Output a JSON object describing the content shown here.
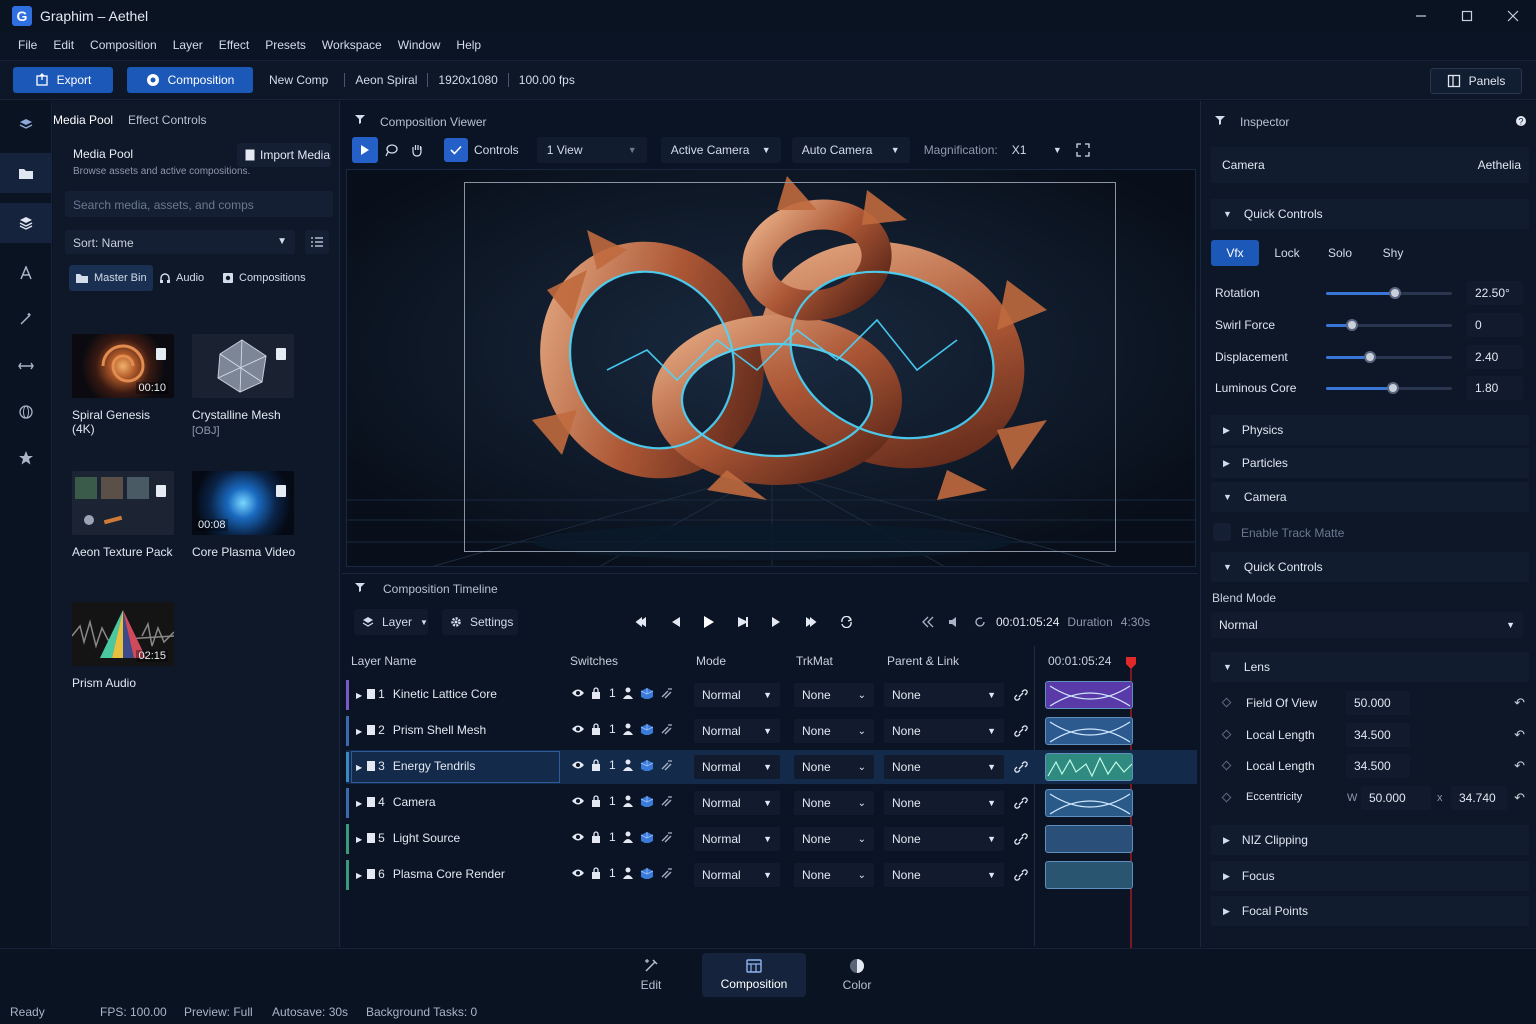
{
  "app": {
    "title": "Graphim – Aethel",
    "logo_letter": "G"
  },
  "menu": [
    "File",
    "Edit",
    "Composition",
    "Layer",
    "Effect",
    "Presets",
    "Workspace",
    "Window",
    "Help"
  ],
  "toolbar": {
    "export": "Export",
    "composition": "Composition",
    "new_comp": "New Comp",
    "comp_name": "Aeon Spiral",
    "resolution": "1920x1080",
    "fps": "100.00 fps",
    "panels": "Panels"
  },
  "left_panel": {
    "tabs": [
      "Media Pool",
      "Effect Controls"
    ],
    "title": "Media Pool",
    "subtitle": "Browse assets and active compositions.",
    "import_button": "Import Media",
    "search_placeholder": "Search media, assets, and comps",
    "sort": "Sort: Name",
    "filters": [
      "Master Bin",
      "Audio",
      "Compositions"
    ],
    "assets": [
      {
        "name": "Spiral Genesis (4K)",
        "sub": "",
        "duration": "00:10"
      },
      {
        "name": "Crystalline Mesh",
        "sub": "[OBJ]",
        "duration": ""
      },
      {
        "name": "Aeon Texture Pack",
        "sub": "",
        "duration": ""
      },
      {
        "name": "Core Plasma Video",
        "sub": "",
        "duration": "00:08"
      },
      {
        "name": "Prism Audio",
        "sub": "",
        "duration": "02:15"
      }
    ]
  },
  "viewer": {
    "title": "Composition Viewer",
    "controls": "Controls",
    "view": "1 View",
    "camera": "Active Camera",
    "auto_camera": "Auto Camera",
    "magnification_label": "Magnification:",
    "magnification": "X1"
  },
  "timeline": {
    "title": "Composition Timeline",
    "layer_btn": "Layer",
    "settings_btn": "Settings",
    "timecode": "00:01:05:24",
    "duration_label": "Duration",
    "duration": "4:30s",
    "columns": {
      "name": "Layer Name",
      "switches": "Switches",
      "mode": "Mode",
      "trkmat": "TrkMat",
      "parent": "Parent & Link",
      "time": "00:01:05:24"
    },
    "layers": [
      {
        "num": "1",
        "name": "Kinetic Lattice Core",
        "mode": "Normal",
        "trkmat": "None",
        "parent": "None",
        "accent": "#7a5ac8",
        "clip": "#5a3aa8"
      },
      {
        "num": "2",
        "name": "Prism Shell Mesh",
        "mode": "Normal",
        "trkmat": "None",
        "parent": "None",
        "accent": "#3a6ab0",
        "clip": "#2c5a8e"
      },
      {
        "num": "3",
        "name": "Energy Tendrils",
        "mode": "Normal",
        "trkmat": "None",
        "parent": "None",
        "accent": "#3a8ac0",
        "clip": "#2f8a80"
      },
      {
        "num": "4",
        "name": "Camera",
        "mode": "Normal",
        "trkmat": "None",
        "parent": "None",
        "accent": "#3a6ab0",
        "clip": "#2a5a88"
      },
      {
        "num": "5",
        "name": "Light Source",
        "mode": "Normal",
        "trkmat": "None",
        "parent": "None",
        "accent": "#3a9a7a",
        "clip": "#2a4f78"
      },
      {
        "num": "6",
        "name": "Plasma Core Render",
        "mode": "Normal",
        "trkmat": "None",
        "parent": "None",
        "accent": "#3a9a7a",
        "clip": "#2a5570"
      }
    ],
    "switch_num": "1"
  },
  "inspector": {
    "title": "Inspector",
    "object_label": "Camera",
    "object_value": "Aethelia",
    "quick_controls": "Quick Controls",
    "qc_buttons": [
      "Vfx",
      "Lock",
      "Solo",
      "Shy"
    ],
    "sliders": [
      {
        "label": "Rotation",
        "value": "22.50°",
        "level": 0.55
      },
      {
        "label": "Swirl Force",
        "value": "0",
        "level": 0.21
      },
      {
        "label": "Displacement",
        "value": "2.40",
        "level": 0.35
      },
      {
        "label": "Luminous Core",
        "value": "1.80",
        "level": 0.53
      }
    ],
    "sections": {
      "physics": "Physics",
      "particles": "Particles",
      "camera": "Camera",
      "track_matte": "Enable Track Matte",
      "quick_controls_2": "Quick Controls",
      "blend_mode_label": "Blend Mode",
      "blend_mode": "Normal",
      "lens": "Lens",
      "niz": "NIZ Clipping",
      "focus": "Focus",
      "focal_points": "Focal Points"
    },
    "lens": {
      "field_of_view_label": "Field Of View",
      "field_of_view": "50.000",
      "local_length_label": "Local Length",
      "local_length": "34.500",
      "local_length2_label": "Local Length",
      "local_length2": "34.500",
      "eccentricity_label": "Eccentricity",
      "w_label": "W",
      "w_value": "50.000",
      "x_label": "x",
      "x_value": "34.740"
    }
  },
  "bottom_nav": [
    "Edit",
    "Composition",
    "Color"
  ],
  "status": {
    "ready": "Ready",
    "fps": "FPS: 100.00",
    "preview": "Preview: Full",
    "autosave": "Autosave: 30s",
    "tasks": "Background Tasks: 0"
  }
}
